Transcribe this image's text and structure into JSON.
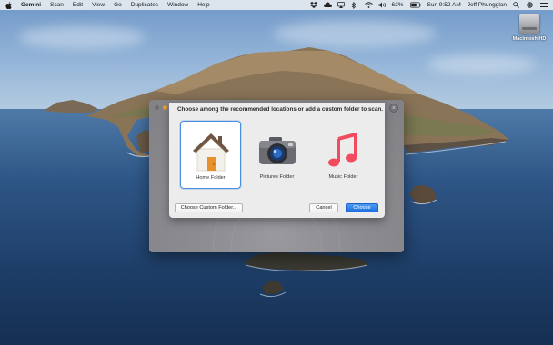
{
  "menubar": {
    "app_name": "Gemini",
    "menus": [
      "Scan",
      "Edit",
      "View",
      "Go",
      "Duplicates",
      "Window",
      "Help"
    ],
    "battery": "63%",
    "clock": "Sun 9:52 AM",
    "user": "Jeff Phungglan",
    "status_icons": [
      "dropbox-icon",
      "cloud-icon",
      "airplay-icon",
      "bluetooth-icon",
      "wifi-icon",
      "volume-icon",
      "battery-icon",
      "search-icon",
      "siri-icon",
      "control-icon"
    ]
  },
  "desktop": {
    "drive_label": "Macintosh HD"
  },
  "dialog": {
    "title": "Choose among the recommended locations or add a custom folder to scan.",
    "locations": [
      {
        "label": "Home Folder",
        "icon": "home-folder-icon",
        "selected": true
      },
      {
        "label": "Pictures Folder",
        "icon": "camera-icon",
        "selected": false
      },
      {
        "label": "Music Folder",
        "icon": "music-note-icon",
        "selected": false
      }
    ],
    "buttons": {
      "custom": "Choose Custom Folder...",
      "cancel": "Cancel",
      "choose": "Choose"
    }
  },
  "colors": {
    "accent": "#4a90e2",
    "primary_button": "#1f6fe0",
    "music_red": "#f24a5f",
    "house_orange": "#e8902d"
  }
}
